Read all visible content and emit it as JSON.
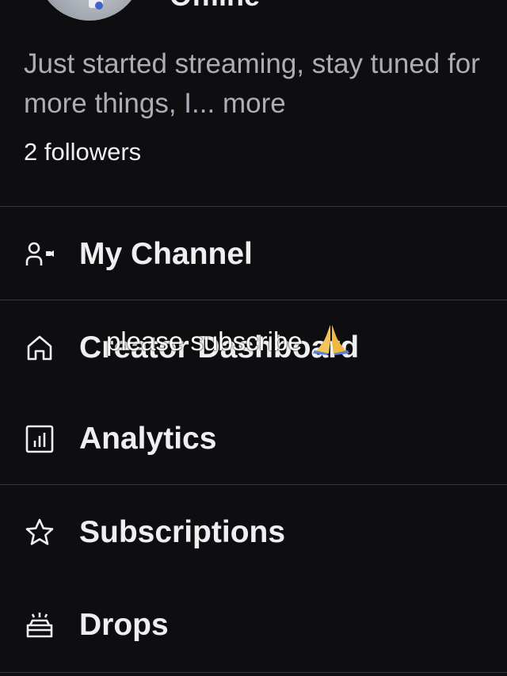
{
  "profile": {
    "username": "Offline",
    "bio_text": "Just started streaming, stay tuned for more things, I...",
    "bio_more": "more",
    "followers": "2 followers"
  },
  "menu": {
    "items": [
      {
        "label": "My Channel",
        "icon": "user-camera-icon"
      },
      {
        "label": "Creator Dashboard",
        "icon": "home-icon"
      },
      {
        "label": "Analytics",
        "icon": "chart-icon"
      },
      {
        "label": "Subscriptions",
        "icon": "star-icon"
      },
      {
        "label": "Drops",
        "icon": "drops-box-icon"
      }
    ]
  },
  "overlay": {
    "caption": "please subscribe",
    "emoji": "praying-hands-emoji"
  },
  "colors": {
    "background": "#0e0e10",
    "text_primary": "#efeff1",
    "text_secondary": "#adadb8",
    "divider": "#35353b"
  }
}
